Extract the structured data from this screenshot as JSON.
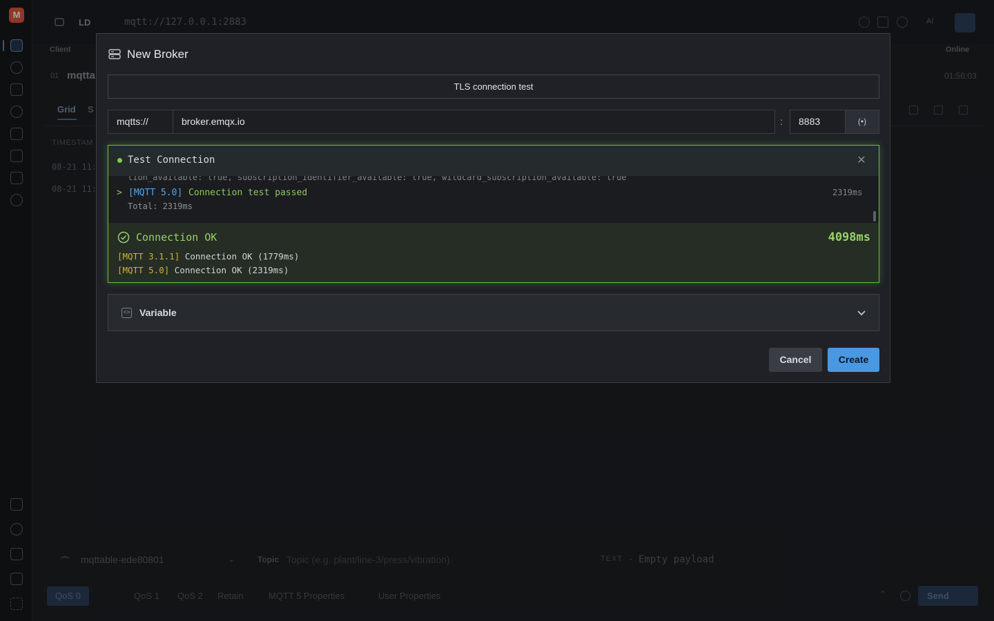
{
  "app": {
    "logo_letter": "M",
    "topbar": {
      "mode": "LD",
      "connection_url": "mqtt://127.0.0.1:2883",
      "ai_label": "AI"
    },
    "clients": {
      "header_left": "Client",
      "header_right": "Online",
      "row_index": "01",
      "row_name": "mqtta",
      "row_time": "01:56:03"
    },
    "message_tabs": {
      "grid": "Grid",
      "second": "S"
    },
    "messages": {
      "column_timestamp": "TIMESTAM",
      "rows": [
        "08-21 11:",
        "08-21 11:"
      ]
    },
    "composer": {
      "connection": "mqttable-ede80801",
      "topic_label": "Topic",
      "topic_placeholder": "Topic (e.g. plant/line-3/press/vibration)",
      "format": "TEXT",
      "format_dash": "-",
      "payload_placeholder": "Empty payload",
      "qos": [
        "QoS 0",
        "QoS 1",
        "QoS 2"
      ],
      "retain": "Retain",
      "mqtt5_props": "MQTT 5 Properties",
      "user_props": "User Properties",
      "send": "Send"
    }
  },
  "modal": {
    "title": "New Broker",
    "broker_name": "TLS connection test",
    "protocol": "mqtts://",
    "host": "broker.emqx.io",
    "port_separator": ":",
    "port": "8883",
    "test_panel": {
      "title": "Test Connection",
      "log_clipped_line": "tion_available: true, subscription_identifier_available: true, wildcard_subscription_available: true",
      "log_prompt": ">",
      "log_tag": "[MQTT 5.0]",
      "log_message": "Connection test passed",
      "log_duration": "2319ms",
      "log_total": "Total: 2319ms",
      "result_title": "Connection OK",
      "result_total": "4098ms",
      "results": [
        {
          "tag": "[MQTT 3.1.1]",
          "text": "Connection OK (1779ms)"
        },
        {
          "tag": "[MQTT 5.0]",
          "text": "Connection OK (2319ms)"
        }
      ]
    },
    "variable_label": "Variable",
    "cancel_label": "Cancel",
    "create_label": "Create"
  },
  "colors": {
    "accent": "#4a98e2",
    "success": "#97d26a",
    "success_border": "#6bbf3f",
    "tag_yellow": "#c9b540",
    "tag_blue": "#58a6e8"
  },
  "icons": [
    "server-icon",
    "broadcast-icon",
    "close-icon",
    "check-circle-icon",
    "variable-icon",
    "chevron-down-icon"
  ]
}
